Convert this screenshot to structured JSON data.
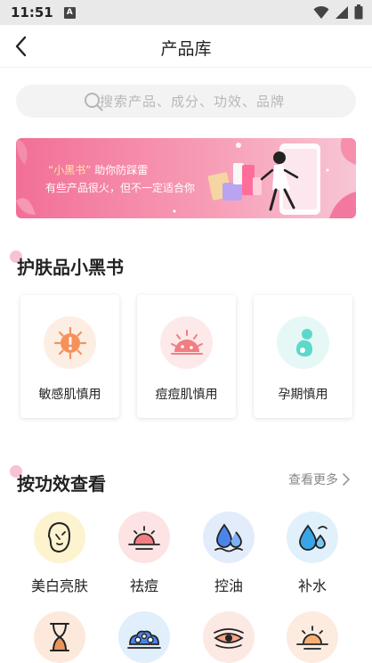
{
  "status_bar": {
    "time": "11:51",
    "notif_glyph": "A"
  },
  "nav": {
    "title": "产品库"
  },
  "search": {
    "placeholder": "搜索产品、成分、功效、品牌"
  },
  "banner": {
    "line1_quote": "“小黑书”",
    "line1_rest": " 助你防踩雷",
    "line2": "有些产品很火，但不一定适合你"
  },
  "blacklist_section": {
    "title": "护肤品小黑书",
    "cards": [
      {
        "label": "敏感肌慎用",
        "icon": "sun-sensitive-icon",
        "bg": "#fdeee3",
        "color": "#f5925c"
      },
      {
        "label": "痘痘肌慎用",
        "icon": "acne-face-icon",
        "bg": "#fde9e9",
        "color": "#f07e82"
      },
      {
        "label": "孕期慎用",
        "icon": "pregnancy-icon",
        "bg": "#e6f8f6",
        "color": "#5dd8cb"
      }
    ]
  },
  "effects_section": {
    "title": "按功效查看",
    "more": "查看更多",
    "items": [
      {
        "label": "美白亮肤",
        "icon": "face-icon",
        "bg": "#fdf3cf"
      },
      {
        "label": "祛痘",
        "icon": "sunrise-acne-icon",
        "bg": "#fde3e3"
      },
      {
        "label": "控油",
        "icon": "oil-drop-icon",
        "bg": "#e3ecfb"
      },
      {
        "label": "补水",
        "icon": "water-drop-icon",
        "bg": "#e1f1fb"
      },
      {
        "label": "",
        "icon": "hourglass-icon",
        "bg": "#fde9dc"
      },
      {
        "label": "",
        "icon": "pores-icon",
        "bg": "#e1eefb"
      },
      {
        "label": "",
        "icon": "eye-icon",
        "bg": "#fde9e3"
      },
      {
        "label": "",
        "icon": "sunrise-icon",
        "bg": "#fdebe0"
      }
    ]
  }
}
